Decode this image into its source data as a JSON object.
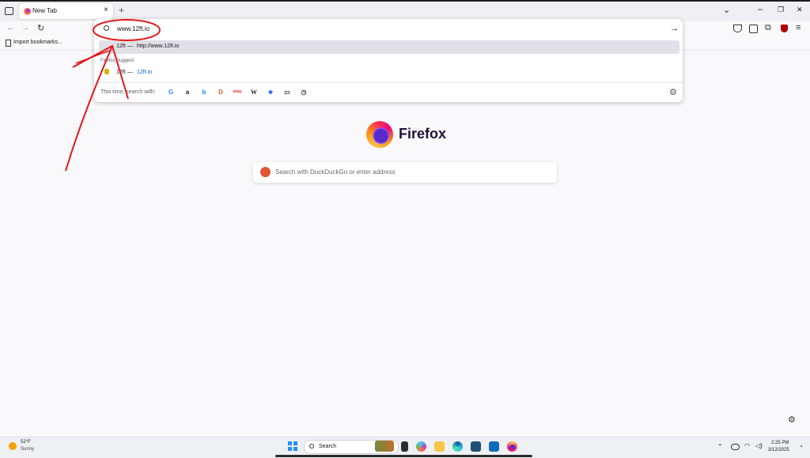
{
  "browser": {
    "tab_title": "New Tab",
    "new_tab_symbol": "+",
    "close_tab_symbol": "×",
    "window_controls": {
      "list_all": "⌄",
      "minimize": "–",
      "restore": "❐",
      "close": "✕"
    }
  },
  "urlbar": {
    "value": "www.12ft.io",
    "go_symbol": "→"
  },
  "bookmarks": {
    "import_label": "Import bookmarks..."
  },
  "suggestions": {
    "top_result": {
      "title": "12ft",
      "separator": "—",
      "url": "http://www.12ft.io"
    },
    "group_label": "Firefox Suggest",
    "items": [
      {
        "title": "12ft",
        "separator": "—",
        "url": "12ft.io"
      }
    ]
  },
  "one_offs": {
    "label": "This time, search with:",
    "engines": [
      {
        "icon": "google-icon",
        "glyph": "G",
        "color": "#4285f4"
      },
      {
        "icon": "amazon-icon",
        "glyph": "a",
        "color": "#222222"
      },
      {
        "icon": "bing-icon",
        "glyph": "b",
        "color": "#1a8be0"
      },
      {
        "icon": "duckduckgo-icon",
        "glyph": "D",
        "color": "#de5833"
      },
      {
        "icon": "ebay-icon",
        "glyph": "ebay",
        "color": "#e53238"
      },
      {
        "icon": "wikipedia-icon",
        "glyph": "W",
        "color": "#222222"
      },
      {
        "icon": "bookmarks-star-icon",
        "glyph": "★",
        "color": "#0b61d6"
      },
      {
        "icon": "tabs-icon",
        "glyph": "▭",
        "color": "#333333"
      },
      {
        "icon": "history-icon",
        "glyph": "◷",
        "color": "#333333"
      }
    ]
  },
  "newtab": {
    "brand": "Firefox",
    "search_placeholder": "Search with DuckDuckGo or enter address"
  },
  "taskbar": {
    "weather_temp": "52°F",
    "weather_desc": "Sunny",
    "search_label": "Search",
    "time": "2:25 PM",
    "date": "3/12/2025"
  },
  "colors": {
    "accent": "#0061e0",
    "annotation": "#e0191b"
  }
}
